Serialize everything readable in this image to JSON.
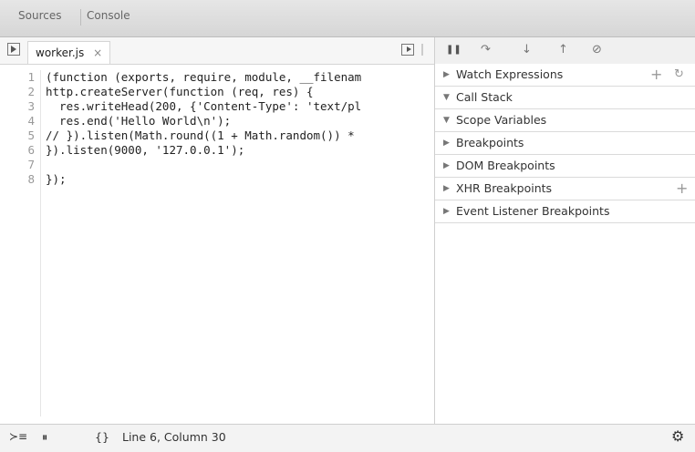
{
  "panels": {
    "sources_label": "Sources",
    "console_label": "Console"
  },
  "editor": {
    "file_tab_label": "worker.js",
    "close_glyph": "×",
    "lines": [
      {
        "num": "1",
        "text": "(function (exports, require, module, __filenam"
      },
      {
        "num": "2",
        "text": "http.createServer(function (req, res) {"
      },
      {
        "num": "3",
        "text": "  res.writeHead(200, {'Content-Type': 'text/pl"
      },
      {
        "num": "4",
        "text": "  res.end('Hello World\\n');"
      },
      {
        "num": "5",
        "text": "// }).listen(Math.round((1 + Math.random()) *"
      },
      {
        "num": "6",
        "text": "}).listen(9000, '127.0.0.1');"
      },
      {
        "num": "7",
        "text": ""
      },
      {
        "num": "8",
        "text": "});"
      }
    ]
  },
  "debugger": {
    "toolbar": {
      "pause_glyph": "❚❚",
      "step_over_glyph": "↷",
      "step_into_glyph": "↓",
      "step_out_glyph": "↑",
      "deactivate_glyph": "⊘"
    },
    "sections": [
      {
        "label": "Watch Expressions",
        "expanded": false
      },
      {
        "label": "Call Stack",
        "expanded": true
      },
      {
        "label": "Scope Variables",
        "expanded": true
      },
      {
        "label": "Breakpoints",
        "expanded": false
      },
      {
        "label": "DOM Breakpoints",
        "expanded": false
      },
      {
        "label": "XHR Breakpoints",
        "expanded": false
      },
      {
        "label": "Event Listener Breakpoints",
        "expanded": false
      }
    ],
    "add_glyph": "+",
    "refresh_glyph": "↻"
  },
  "status": {
    "console_glyph": "≻≡",
    "pause_exceptions_glyph": "⏸",
    "pretty_print_glyph": "{}",
    "cursor_position": "Line 6, Column 30",
    "settings_glyph": "⚙"
  }
}
